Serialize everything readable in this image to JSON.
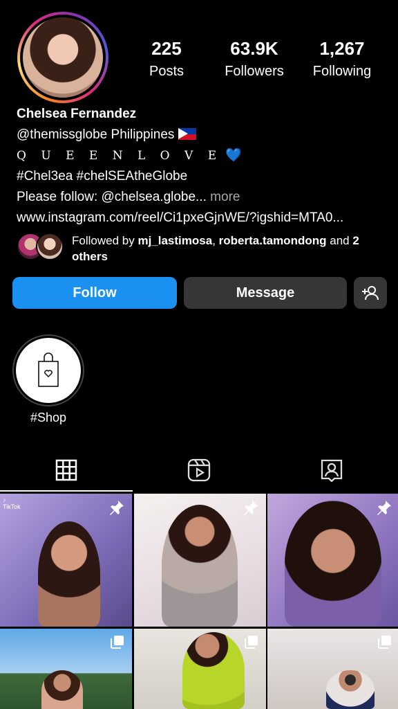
{
  "profile": {
    "stats": {
      "posts_count": "225",
      "posts_label": "Posts",
      "followers_count": "63.9K",
      "followers_label": "Followers",
      "following_count": "1,267",
      "following_label": "Following"
    },
    "name": "Chelsea Fernandez",
    "bio": {
      "line1_handle": "@themissglobe",
      "line1_text": "Philippines",
      "line2": "Q U E E N  L O V E",
      "line2_emoji": "💙",
      "line3": "#Chel3ea #chelSEAtheGlobe",
      "line4": "Please follow: @chelsea.globe...",
      "line4_more": "more",
      "link": "www.instagram.com/reel/Ci1pxeGjnWE/?igshid=MTA0..."
    },
    "followed_by": {
      "prefix": "Followed by",
      "user1": "mj_lastimosa",
      "sep": ",",
      "user2": "roberta.tamondong",
      "and": "and",
      "others": "2 others"
    }
  },
  "actions": {
    "follow_label": "Follow",
    "message_label": "Message",
    "add_person_icon": "add-person-icon"
  },
  "highlights": [
    {
      "label": "#Shop",
      "icon": "shopping-bag-heart-icon"
    }
  ],
  "tabs": [
    {
      "name": "posts",
      "icon": "grid-icon",
      "active": true
    },
    {
      "name": "reels",
      "icon": "reels-icon",
      "active": false
    },
    {
      "name": "tagged",
      "icon": "tagged-person-icon",
      "active": false
    }
  ],
  "grid": {
    "cells": [
      {
        "pinned": true,
        "badge": "TikTok"
      },
      {
        "pinned": true
      },
      {
        "pinned": true
      },
      {
        "multi": true
      },
      {
        "multi": true
      },
      {
        "multi": true
      }
    ]
  },
  "colors": {
    "follow_button": "#1a91f0",
    "secondary_button": "#363636",
    "background": "#000000"
  }
}
